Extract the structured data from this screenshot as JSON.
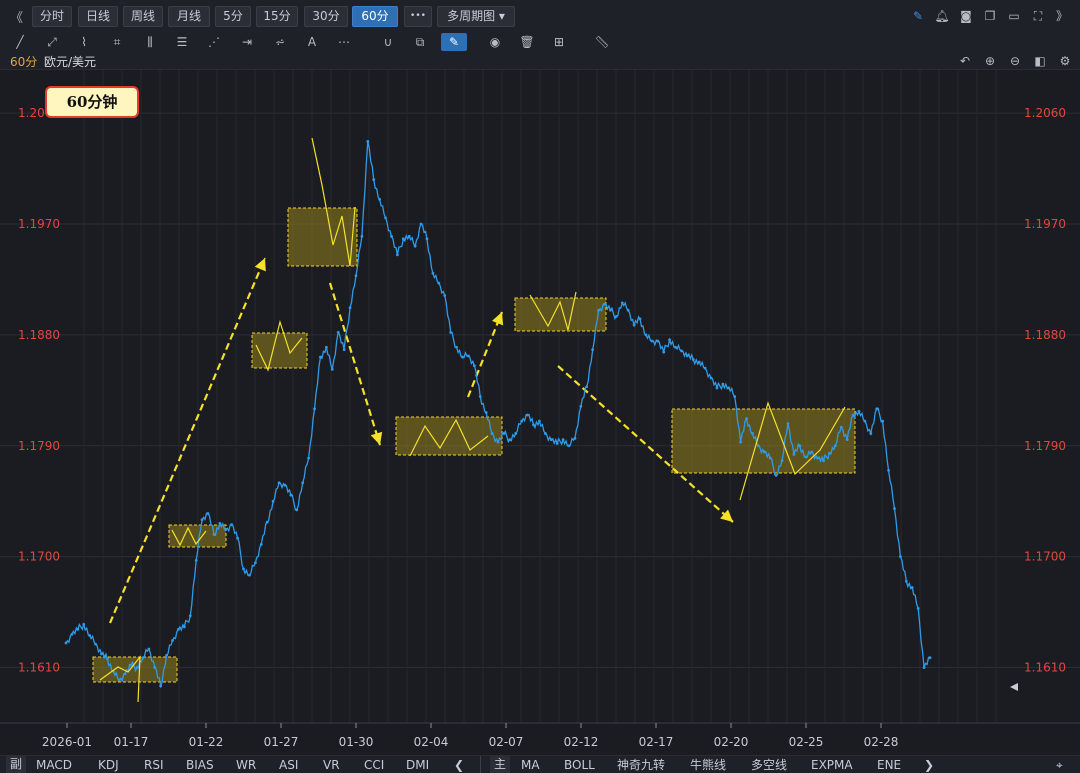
{
  "toolbar": {
    "nav_back": "《",
    "periods": [
      {
        "label": "分时",
        "active": false
      },
      {
        "label": "日线",
        "active": false
      },
      {
        "label": "周线",
        "active": false
      },
      {
        "label": "月线",
        "active": false
      },
      {
        "label": "5分",
        "active": false
      },
      {
        "label": "15分",
        "active": false
      },
      {
        "label": "30分",
        "active": false
      },
      {
        "label": "60分",
        "active": true
      }
    ],
    "more": "•••",
    "multi_period": "多周期图 ▾",
    "right_icons": [
      "pencil-icon",
      "bell-icon",
      "camera-icon",
      "copy-icon",
      "monitor-icon",
      "fullscreen-icon",
      "collapse-icon"
    ],
    "nav_forward": "》"
  },
  "drawtools": [
    "line-tool-icon",
    "ray-tool-icon",
    "polyline-tool-icon",
    "crop-tool-icon",
    "parallel-tool-icon",
    "fib-tool-icon",
    "fan-tool-icon",
    "measure-tool-icon",
    "gann-tool-icon",
    "text-tool-icon",
    "more-tools-icon",
    "magnet-icon",
    "layers-icon",
    "brush-icon",
    "eye-icon",
    "trash-icon",
    "group-icon",
    "ruler-icon"
  ],
  "header": {
    "period": "60分",
    "symbol": "欧元/美元",
    "icons": [
      "undo-icon",
      "zoom-in-icon",
      "zoom-out-icon",
      "split-icon",
      "settings-icon"
    ]
  },
  "badge": "60分钟",
  "accent": "#2f6fb3",
  "line_color": "#2f9be8",
  "annotation_color": "#f5e12a",
  "chart_data": {
    "type": "line",
    "title": "",
    "series": [
      {
        "values": [
          1.163,
          1.1637,
          1.1641,
          1.1645,
          1.1636,
          1.1629,
          1.1621,
          1.1617,
          1.1607,
          1.16,
          1.1605,
          1.1612,
          1.161,
          1.1618,
          1.1625,
          1.161,
          1.1595,
          1.162,
          1.1632,
          1.1641,
          1.1643,
          1.1652,
          1.1697,
          1.173,
          1.1735,
          1.1718,
          1.1727,
          1.1722,
          1.1726,
          1.1715,
          1.169,
          1.1685,
          1.1695,
          1.171,
          1.1728,
          1.1745,
          1.176,
          1.1758,
          1.175,
          1.1738,
          1.176,
          1.178,
          1.182,
          1.1862,
          1.187,
          1.1852,
          1.1882,
          1.1868,
          1.1902,
          1.1928,
          1.196,
          1.2037,
          1.2006,
          1.199,
          1.1975,
          1.196,
          1.1945,
          1.1958,
          1.196,
          1.1952,
          1.197,
          1.1958,
          1.193,
          1.1922,
          1.1912,
          1.1882,
          1.187,
          1.1862,
          1.1863,
          1.1855,
          1.183,
          1.1817,
          1.18,
          1.1793,
          1.18,
          1.1795,
          1.18,
          1.181,
          1.1815,
          1.1807,
          1.181,
          1.18,
          1.1795,
          1.1792,
          1.1795,
          1.179,
          1.1796,
          1.1822,
          1.1838,
          1.1868,
          1.19,
          1.1905,
          1.19,
          1.1895,
          1.1906,
          1.19,
          1.1888,
          1.1893,
          1.188,
          1.1875,
          1.1875,
          1.1866,
          1.1876,
          1.187,
          1.1867,
          1.1863,
          1.186,
          1.1858,
          1.1853,
          1.1845,
          1.1837,
          1.184,
          1.1837,
          1.183,
          1.1793,
          1.1812,
          1.18,
          1.179,
          1.1785,
          1.178,
          1.1766,
          1.1778,
          1.1808,
          1.1783,
          1.179,
          1.1781,
          1.1785,
          1.178,
          1.1778,
          1.1784,
          1.179,
          1.1805,
          1.1795,
          1.1815,
          1.1818,
          1.181,
          1.18,
          1.182,
          1.181,
          1.177,
          1.1739,
          1.17,
          1.168,
          1.1675,
          1.1658,
          1.161,
          1.1618
        ]
      }
    ],
    "x_tick_labels": [
      "2026-01",
      "01-17",
      "01-22",
      "01-27",
      "01-30",
      "02-04",
      "02-07",
      "02-12",
      "02-17",
      "02-20",
      "02-25",
      "02-28"
    ],
    "y_tick_labels": [
      "1.2060",
      "1.1970",
      "1.1880",
      "1.1790",
      "1.1700",
      "1.1610"
    ],
    "ylim": [
      1.1565,
      1.2095
    ],
    "grid": true
  },
  "bottom": {
    "sub_label": "副",
    "sub_tabs": [
      "MACD",
      "KDJ",
      "RSI",
      "BIAS",
      "WR",
      "ASI",
      "VR",
      "CCI",
      "DMI"
    ],
    "prev": "❮",
    "main_label": "主",
    "main_tabs": [
      "MA",
      "BOLL",
      "神奇九转",
      "牛熊线",
      "多空线",
      "EXPMA",
      "ENE"
    ],
    "next": "❯",
    "location_icon": "location-pin-icon"
  }
}
